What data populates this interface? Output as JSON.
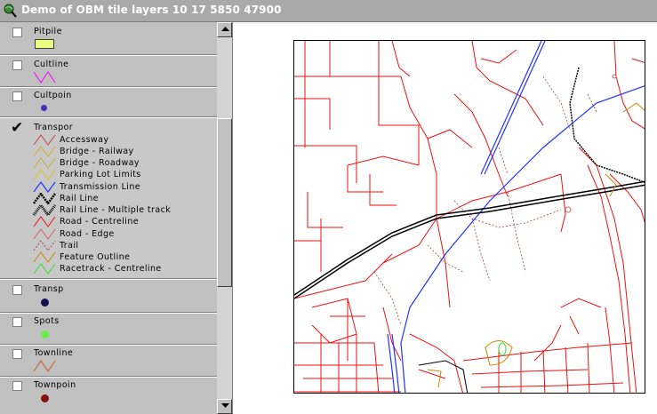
{
  "window": {
    "title": "Demo of OBM tile layers 10 17 5850 47900",
    "icon": "globe-search-icon"
  },
  "legend": {
    "layers": [
      {
        "name": "Pitpile",
        "checked": false,
        "symbol": "fill-swatch",
        "color": "#e8ff80"
      },
      {
        "name": "Cultline",
        "checked": false,
        "symbol": "line",
        "color": "#ff00ff"
      },
      {
        "name": "Cultpoin",
        "checked": false,
        "symbol": "point",
        "color": "#4030c0"
      },
      {
        "name": "Transpor",
        "checked": true,
        "symbol": "group",
        "color": "#000000"
      },
      {
        "name": "Transp",
        "checked": false,
        "symbol": "point",
        "color": "#101050"
      },
      {
        "name": "Spots",
        "checked": false,
        "symbol": "point",
        "color": "#66ee44"
      },
      {
        "name": "Townline",
        "checked": false,
        "symbol": "line",
        "color": "#cc5522"
      },
      {
        "name": "Townpoin",
        "checked": false,
        "symbol": "point",
        "color": "#8a1010"
      }
    ],
    "transpor_classes": [
      {
        "label": "Accessway",
        "color": "#cc4444"
      },
      {
        "label": "Bridge - Railway",
        "color": "#ddaa22"
      },
      {
        "label": "Bridge - Roadway",
        "color": "#ccaa33"
      },
      {
        "label": "Parking Lot Limits",
        "color": "#e0c020"
      },
      {
        "label": "Transmission Line",
        "color": "#2233ff"
      },
      {
        "label": "Rail Line",
        "color": "#000000"
      },
      {
        "label": "Rail Line - Multiple track",
        "color": "#000000"
      },
      {
        "label": "Road - Centreline",
        "color": "#ee1111"
      },
      {
        "label": "Road - Edge",
        "color": "#cc6666"
      },
      {
        "label": "Trail",
        "color": "#994444"
      },
      {
        "label": "Feature Outline",
        "color": "#cc8800"
      },
      {
        "label": "Racetrack - Centreline",
        "color": "#33dd33"
      }
    ]
  },
  "colors": {
    "road": "#ee1111",
    "transmission": "#2233ff",
    "rail": "#000000",
    "trail": "#994444",
    "feature": "#cc8800",
    "racetrack": "#33dd33"
  }
}
